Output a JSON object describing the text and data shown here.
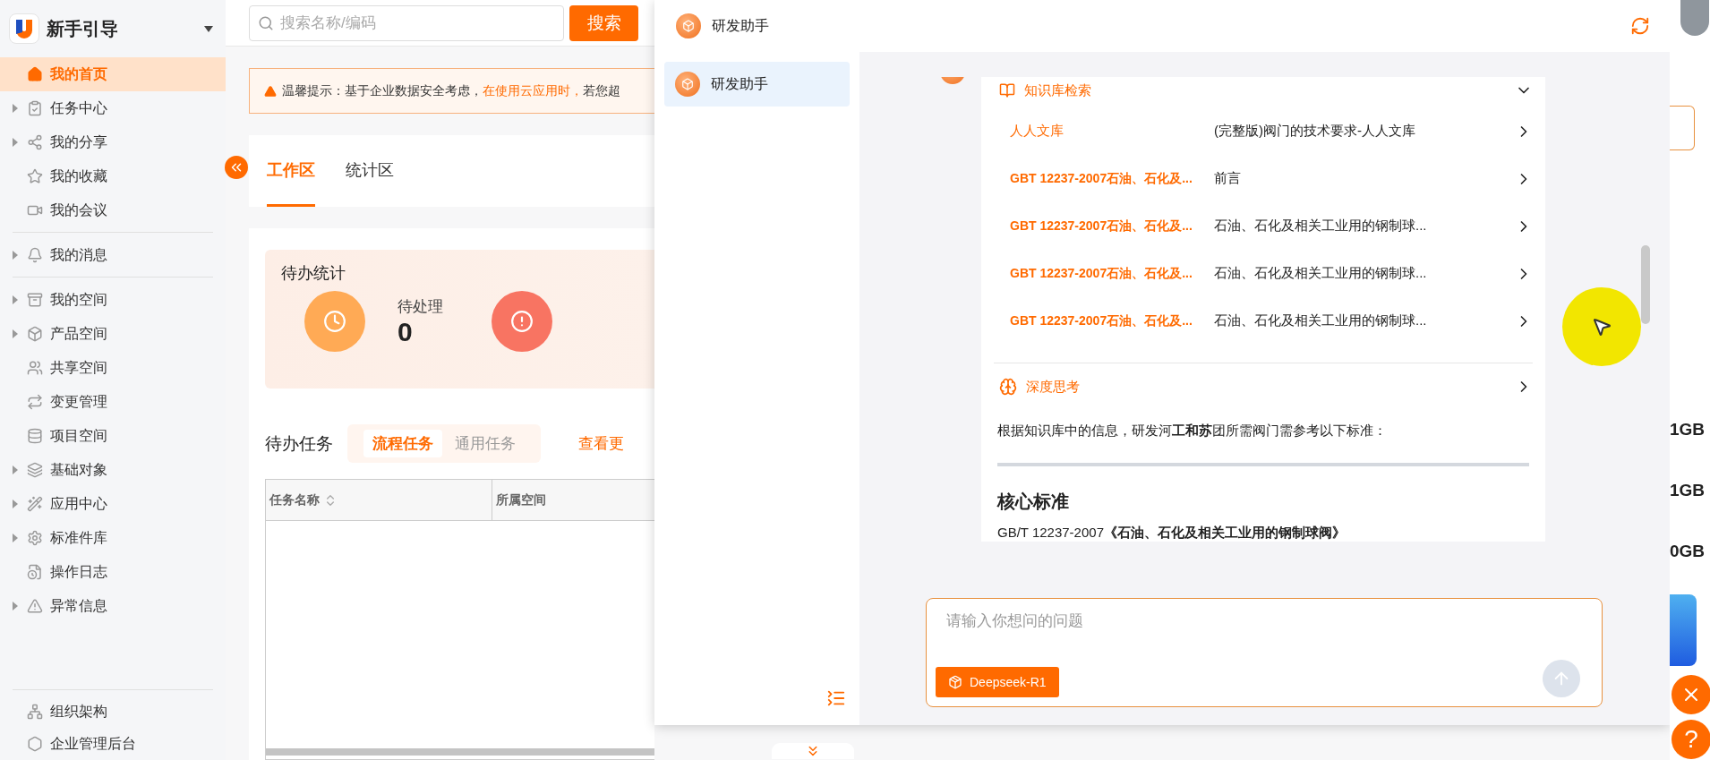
{
  "app": {
    "title": "新手引导"
  },
  "sidebar": {
    "sections": [
      {
        "items": [
          {
            "label": "我的首页",
            "has_children": false,
            "selected": true
          },
          {
            "label": "任务中心",
            "has_children": true,
            "selected": false
          },
          {
            "label": "我的分享",
            "has_children": true,
            "selected": false
          },
          {
            "label": "我的收藏",
            "has_children": false,
            "selected": false
          },
          {
            "label": "我的会议",
            "has_children": false,
            "selected": false
          }
        ]
      },
      {
        "items": [
          {
            "label": "我的消息",
            "has_children": true,
            "selected": false
          }
        ]
      },
      {
        "items": [
          {
            "label": "我的空间",
            "has_children": true,
            "selected": false
          },
          {
            "label": "产品空间",
            "has_children": true,
            "selected": false
          },
          {
            "label": "共享空间",
            "has_children": false,
            "selected": false
          },
          {
            "label": "变更管理",
            "has_children": false,
            "selected": false
          },
          {
            "label": "项目空间",
            "has_children": false,
            "selected": false
          },
          {
            "label": "基础对象",
            "has_children": true,
            "selected": false
          },
          {
            "label": "应用中心",
            "has_children": true,
            "selected": false
          },
          {
            "label": "标准件库",
            "has_children": true,
            "selected": false
          },
          {
            "label": "操作日志",
            "has_children": false,
            "selected": false
          },
          {
            "label": "异常信息",
            "has_children": true,
            "selected": false
          }
        ]
      }
    ],
    "bottom_items": [
      {
        "label": "组织架构",
        "selected": false
      },
      {
        "label": "企业管理后台",
        "selected": false
      }
    ]
  },
  "search": {
    "placeholder": "搜索名称/编码",
    "button": "搜索"
  },
  "notice": {
    "segments": [
      {
        "text": "温馨提示：基于企业数据安全考虑，",
        "highlight": false
      },
      {
        "text": "在使用云应用时，",
        "highlight": true
      },
      {
        "text": "若您超",
        "highlight": false
      }
    ]
  },
  "tabs": [
    {
      "label": "工作区",
      "selected": true
    },
    {
      "label": "统计区",
      "selected": false
    }
  ],
  "todo_stats": {
    "title": "待办统计",
    "stats": [
      {
        "kind": "pending",
        "label": "待处理",
        "value": "0"
      },
      {
        "kind": "overdue"
      }
    ]
  },
  "todo_tasks": {
    "title": "待办任务",
    "filters": [
      {
        "label": "流程任务",
        "selected": true
      },
      {
        "label": "通用任务",
        "selected": false
      }
    ],
    "more": "查看更",
    "columns": [
      "任务名称",
      "所属空间"
    ]
  },
  "assistant": {
    "title": "研发助手",
    "conversations": [
      {
        "label": "研发助手",
        "selected": true
      }
    ],
    "retrieval": {
      "title": "知识库检索",
      "expanded": true,
      "results": [
        {
          "source": "人人文库",
          "title": "(完整版)阀门的技术要求-人人文库"
        },
        {
          "source": "GBT 12237-2007石油、石化及...",
          "title": "前言"
        },
        {
          "source": "GBT 12237-2007石油、石化及...",
          "title": "石油、石化及相关工业用的钢制球..."
        },
        {
          "source": "GBT 12237-2007石油、石化及...",
          "title": "石油、石化及相关工业用的钢制球..."
        },
        {
          "source": "GBT 12237-2007石油、石化及...",
          "title": "石油、石化及相关工业用的钢制球..."
        }
      ]
    },
    "thinking": {
      "title": "深度思考",
      "expanded": false
    },
    "answer": {
      "paragraph": "根据知识库中的信息，研发河**工和苏**团所需阀门需参考以下标准：",
      "heading": "核心标准",
      "line": "GB/T 12237-2007**《石油、石化及相关工业用的钢制球阀》**"
    },
    "input": {
      "placeholder": "请输入你想问的问题",
      "model": "Deepseek-R1"
    }
  },
  "right_strip": {
    "values": [
      "1GB",
      "1GB",
      "0GB"
    ],
    "help": "?"
  }
}
